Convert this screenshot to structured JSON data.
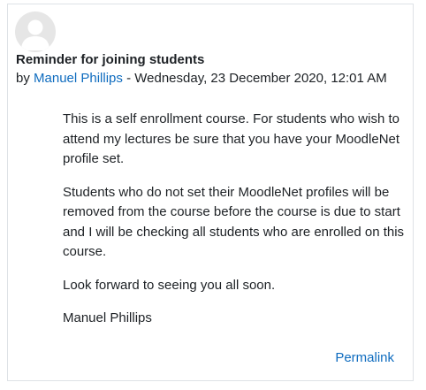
{
  "post": {
    "subject": "Reminder for joining students",
    "by_prefix": "by ",
    "author": "Manuel Phillips",
    "date_separator": " - ",
    "date": "Wednesday, 23 December 2020, 12:01 AM",
    "paragraphs": [
      "This is a self enrollment course. For students who wish to attend my lectures be sure that you have your MoodleNet profile set.",
      "Students who do not set their MoodleNet profiles will be removed from the course before the course is due to start and I will be checking all students who are enrolled on this course.",
      "Look forward to seeing you all soon.",
      "Manuel Phillips"
    ],
    "permalink_label": "Permalink"
  },
  "colors": {
    "link": "#0f6cbf",
    "text": "#1d2125",
    "border": "#dee2e6",
    "avatar_bg": "#e6e6e6",
    "avatar_fg": "#ffffff"
  }
}
